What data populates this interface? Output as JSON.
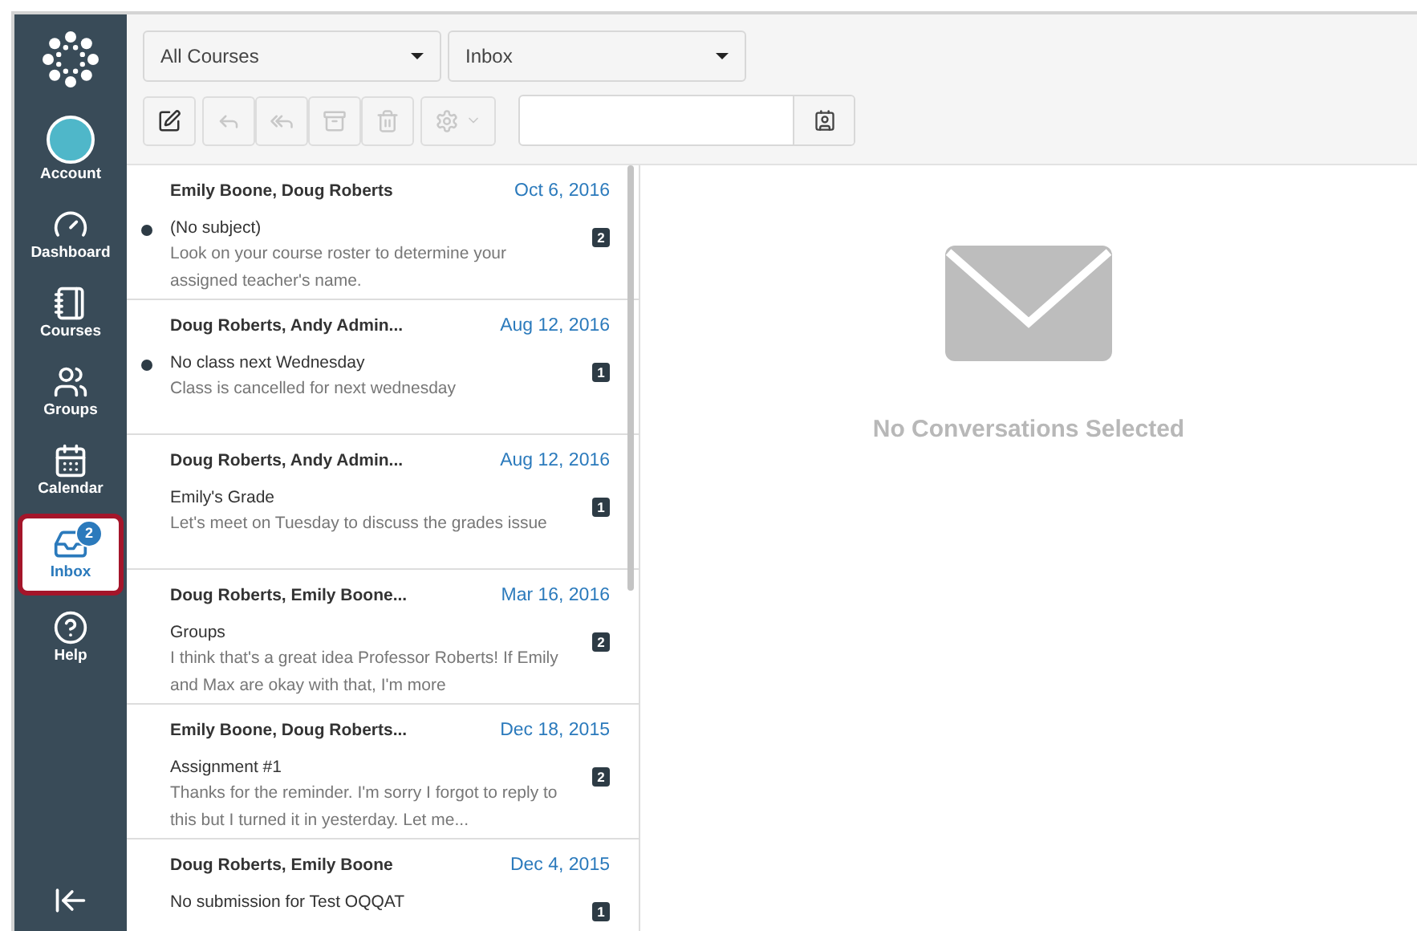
{
  "nav": [
    {
      "kind": "account",
      "label": "Account",
      "selected": false
    },
    {
      "kind": "dashboard",
      "label": "Dashboard",
      "selected": false
    },
    {
      "kind": "courses",
      "label": "Courses",
      "selected": false
    },
    {
      "kind": "groups",
      "label": "Groups",
      "selected": false
    },
    {
      "kind": "calendar",
      "label": "Calendar",
      "selected": false
    },
    {
      "kind": "inbox",
      "label": "Inbox",
      "selected": true,
      "badge": "2"
    },
    {
      "kind": "help",
      "label": "Help",
      "selected": false
    }
  ],
  "filters": {
    "course": "All Courses",
    "mailbox": "Inbox"
  },
  "conversations": [
    {
      "participants": "Emily Boone, Doug Roberts",
      "date": "Oct 6, 2016",
      "subject": "(No subject)",
      "count": "2",
      "unread": true,
      "preview": "Look on your course roster to determine your assigned teacher's name."
    },
    {
      "participants": "Doug Roberts, Andy Admin...",
      "date": "Aug 12, 2016",
      "subject": "No class next Wednesday",
      "count": "1",
      "unread": true,
      "preview": "Class is cancelled for next wednesday"
    },
    {
      "participants": "Doug Roberts, Andy Admin...",
      "date": "Aug 12, 2016",
      "subject": "Emily's Grade",
      "count": "1",
      "unread": false,
      "preview": "Let's meet on Tuesday to discuss the grades issue"
    },
    {
      "participants": "Doug Roberts, Emily Boone...",
      "date": "Mar 16, 2016",
      "subject": "Groups",
      "count": "2",
      "unread": false,
      "preview": "I think that's a great idea Professor Roberts! If Emily and Max are okay with that, I'm more"
    },
    {
      "participants": "Emily Boone, Doug Roberts...",
      "date": "Dec 18, 2015",
      "subject": "Assignment #1",
      "count": "2",
      "unread": false,
      "preview": "Thanks for the reminder. I'm sorry I forgot to reply to this but I turned it in yesterday. Let me..."
    },
    {
      "participants": "Doug Roberts, Emily Boone",
      "date": "Dec 4, 2015",
      "subject": "No submission for Test OQQAT",
      "count": "1",
      "unread": false
    }
  ],
  "detail": {
    "message": "No Conversations Selected"
  }
}
